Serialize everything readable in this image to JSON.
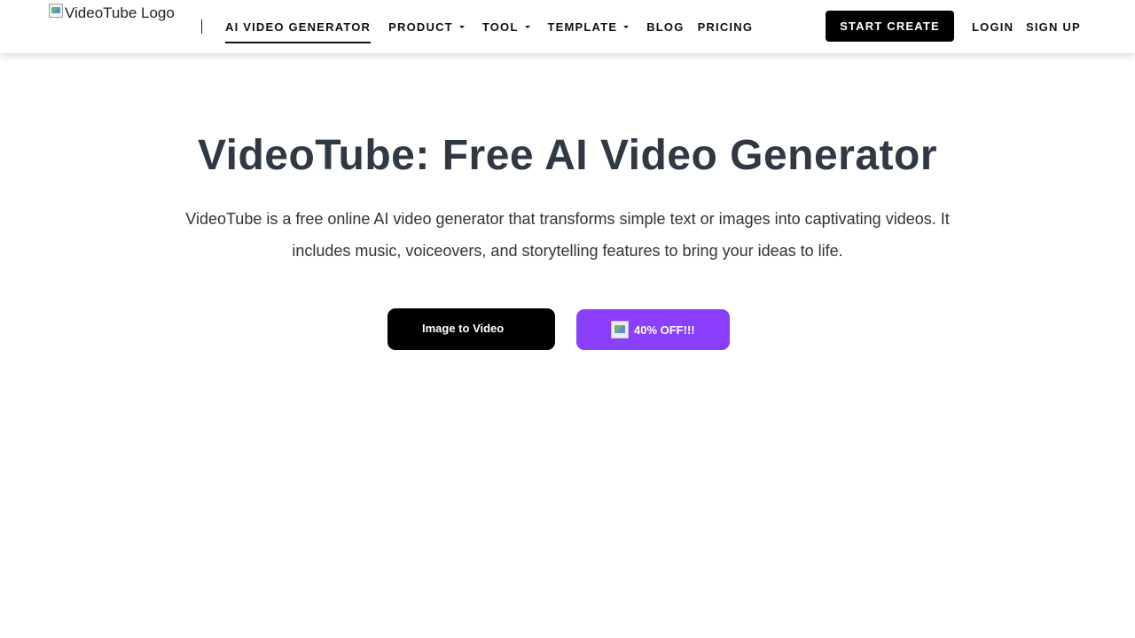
{
  "header": {
    "logo_alt": "VideoTube Logo",
    "nav": [
      {
        "label": "AI VIDEO GENERATOR",
        "active": true,
        "dropdown": false
      },
      {
        "label": "PRODUCT",
        "active": false,
        "dropdown": true
      },
      {
        "label": "TOOL",
        "active": false,
        "dropdown": true
      },
      {
        "label": "TEMPLATE",
        "active": false,
        "dropdown": true
      },
      {
        "label": "BLOG",
        "active": false,
        "dropdown": false
      },
      {
        "label": "PRICING",
        "active": false,
        "dropdown": false
      }
    ],
    "start_create_label": "START CREATE",
    "login_label": "LOGIN",
    "signup_label": "SIGN UP"
  },
  "hero": {
    "title": "VideoTube: Free AI Video Generator",
    "description": "VideoTube is a free online AI video generator that transforms simple text or images into captivating videos. It includes music, voiceovers, and storytelling features to bring your ideas to life.",
    "primary_button": "Image to Video",
    "offer_button": "40% OFF!!!"
  },
  "colors": {
    "title": "#2f3843",
    "offer_accent": "#8a3ffc",
    "primary_button": "#000000"
  }
}
